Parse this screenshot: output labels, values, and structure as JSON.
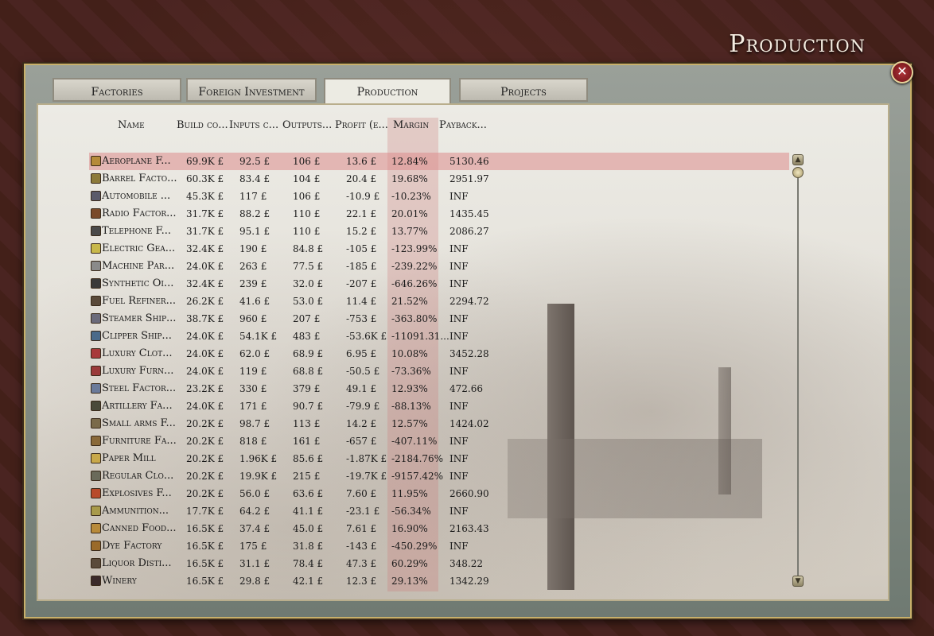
{
  "window_title": "Production",
  "close_glyph": "✕",
  "tabs": [
    {
      "label": "Factories",
      "active": false
    },
    {
      "label": "Foreign Investment",
      "active": false
    },
    {
      "label": "Production",
      "active": true
    },
    {
      "label": "Projects",
      "active": false
    }
  ],
  "columns": [
    "Name",
    "Build co...",
    "Inputs c...",
    "Outputs...",
    "Profit (e...",
    "Margin",
    "Payback..."
  ],
  "rows": [
    {
      "name": "Aeroplane F...",
      "build": "69.9K £",
      "inputs": "92.5 £",
      "outputs": "106 £",
      "profit": "13.6 £",
      "margin": "12.84%",
      "payback": "5130.46",
      "icon_color": "#b58b3a",
      "selected": true
    },
    {
      "name": "Barrel Facto...",
      "build": "60.3K £",
      "inputs": "83.4 £",
      "outputs": "104 £",
      "profit": "20.4 £",
      "margin": "19.68%",
      "payback": "2951.97",
      "icon_color": "#8c7a3a"
    },
    {
      "name": "Automobile ...",
      "build": "45.3K £",
      "inputs": "117 £",
      "outputs": "106 £",
      "profit": "-10.9 £",
      "margin": "-10.23%",
      "payback": "INF",
      "icon_color": "#5a5a6a"
    },
    {
      "name": "Radio Factor...",
      "build": "31.7K £",
      "inputs": "88.2 £",
      "outputs": "110 £",
      "profit": "22.1 £",
      "margin": "20.01%",
      "payback": "1435.45",
      "icon_color": "#7a4a2a"
    },
    {
      "name": "Telephone F...",
      "build": "31.7K £",
      "inputs": "95.1 £",
      "outputs": "110 £",
      "profit": "15.2 £",
      "margin": "13.77%",
      "payback": "2086.27",
      "icon_color": "#4a4a4a"
    },
    {
      "name": "Electric Gea...",
      "build": "32.4K £",
      "inputs": "190 £",
      "outputs": "84.8 £",
      "profit": "-105 £",
      "margin": "-123.99%",
      "payback": "INF",
      "icon_color": "#c8b84a"
    },
    {
      "name": "Machine Par...",
      "build": "24.0K £",
      "inputs": "263 £",
      "outputs": "77.5 £",
      "profit": "-185 £",
      "margin": "-239.22%",
      "payback": "INF",
      "icon_color": "#8a8a8a"
    },
    {
      "name": "Synthetic Oi...",
      "build": "32.4K £",
      "inputs": "239 £",
      "outputs": "32.0 £",
      "profit": "-207 £",
      "margin": "-646.26%",
      "payback": "INF",
      "icon_color": "#3a3a3a"
    },
    {
      "name": "Fuel Refiner...",
      "build": "26.2K £",
      "inputs": "41.6 £",
      "outputs": "53.0 £",
      "profit": "11.4 £",
      "margin": "21.52%",
      "payback": "2294.72",
      "icon_color": "#5a4a3a"
    },
    {
      "name": "Steamer Ship...",
      "build": "38.7K £",
      "inputs": "960 £",
      "outputs": "207 £",
      "profit": "-753 £",
      "margin": "-363.80%",
      "payback": "INF",
      "icon_color": "#6a6a7a"
    },
    {
      "name": "Clipper Ship...",
      "build": "24.0K £",
      "inputs": "54.1K £",
      "outputs": "483 £",
      "profit": "-53.6K £",
      "margin": "-11091.31...",
      "payback": "INF",
      "icon_color": "#4a6a8a"
    },
    {
      "name": "Luxury Clot...",
      "build": "24.0K £",
      "inputs": "62.0 £",
      "outputs": "68.9 £",
      "profit": "6.95 £",
      "margin": "10.08%",
      "payback": "3452.28",
      "icon_color": "#a83a3a"
    },
    {
      "name": "Luxury Furn...",
      "build": "24.0K £",
      "inputs": "119 £",
      "outputs": "68.8 £",
      "profit": "-50.5 £",
      "margin": "-73.36%",
      "payback": "INF",
      "icon_color": "#9a3a3a"
    },
    {
      "name": "Steel Factor...",
      "build": "23.2K £",
      "inputs": "330 £",
      "outputs": "379 £",
      "profit": "49.1 £",
      "margin": "12.93%",
      "payback": "472.66",
      "icon_color": "#6a7a9a"
    },
    {
      "name": "Artillery Fa...",
      "build": "24.0K £",
      "inputs": "171 £",
      "outputs": "90.7 £",
      "profit": "-79.9 £",
      "margin": "-88.13%",
      "payback": "INF",
      "icon_color": "#4a4a3a"
    },
    {
      "name": "Small arms F...",
      "build": "20.2K £",
      "inputs": "98.7 £",
      "outputs": "113 £",
      "profit": "14.2 £",
      "margin": "12.57%",
      "payback": "1424.02",
      "icon_color": "#7a6a4a"
    },
    {
      "name": "Furniture Fa...",
      "build": "20.2K £",
      "inputs": "818 £",
      "outputs": "161 £",
      "profit": "-657 £",
      "margin": "-407.11%",
      "payback": "INF",
      "icon_color": "#8a6a3a"
    },
    {
      "name": "Paper Mill",
      "build": "20.2K £",
      "inputs": "1.96K £",
      "outputs": "85.6 £",
      "profit": "-1.87K £",
      "margin": "-2184.76%",
      "payback": "INF",
      "icon_color": "#c8a84a"
    },
    {
      "name": "Regular Clo...",
      "build": "20.2K £",
      "inputs": "19.9K £",
      "outputs": "215 £",
      "profit": "-19.7K £",
      "margin": "-9157.42%",
      "payback": "INF",
      "icon_color": "#6a6a5a"
    },
    {
      "name": "Explosives F...",
      "build": "20.2K £",
      "inputs": "56.0 £",
      "outputs": "63.6 £",
      "profit": "7.60 £",
      "margin": "11.95%",
      "payback": "2660.90",
      "icon_color": "#b84a2a"
    },
    {
      "name": "Ammunition...",
      "build": "17.7K £",
      "inputs": "64.2 £",
      "outputs": "41.1 £",
      "profit": "-23.1 £",
      "margin": "-56.34%",
      "payback": "INF",
      "icon_color": "#a89a4a"
    },
    {
      "name": "Canned Food...",
      "build": "16.5K £",
      "inputs": "37.4 £",
      "outputs": "45.0 £",
      "profit": "7.61 £",
      "margin": "16.90%",
      "payback": "2163.43",
      "icon_color": "#b88a3a"
    },
    {
      "name": "Dye Factory",
      "build": "16.5K £",
      "inputs": "175 £",
      "outputs": "31.8 £",
      "profit": "-143 £",
      "margin": "-450.29%",
      "payback": "INF",
      "icon_color": "#9a6a2a"
    },
    {
      "name": "Liquor Disti...",
      "build": "16.5K £",
      "inputs": "31.1 £",
      "outputs": "78.4 £",
      "profit": "47.3 £",
      "margin": "60.29%",
      "payback": "348.22",
      "icon_color": "#5a4a3a"
    },
    {
      "name": "Winery",
      "build": "16.5K £",
      "inputs": "29.8 £",
      "outputs": "42.1 £",
      "profit": "12.3 £",
      "margin": "29.13%",
      "payback": "1342.29",
      "icon_color": "#3a2a2a"
    }
  ]
}
